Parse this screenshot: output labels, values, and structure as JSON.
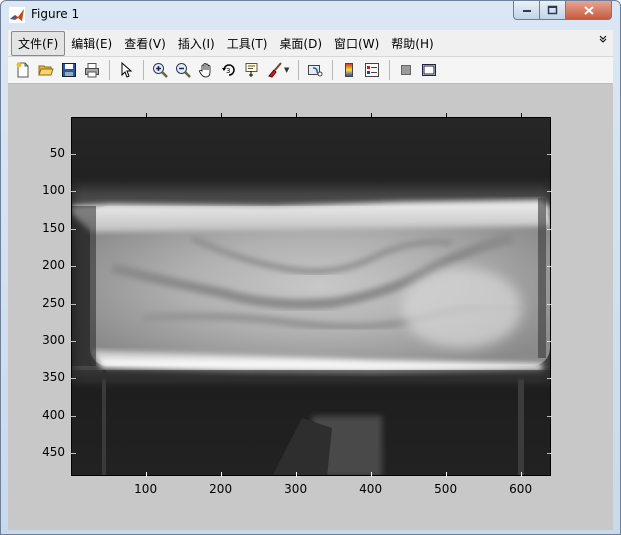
{
  "window": {
    "title": "Figure 1",
    "controls": {
      "minimize": "minimize",
      "maximize": "maximize",
      "close": "close"
    }
  },
  "menubar": {
    "items": [
      {
        "label": "文件(F)",
        "active": true
      },
      {
        "label": "编辑(E)"
      },
      {
        "label": "查看(V)"
      },
      {
        "label": "插入(I)"
      },
      {
        "label": "工具(T)"
      },
      {
        "label": "桌面(D)"
      },
      {
        "label": "窗口(W)"
      },
      {
        "label": "帮助(H)"
      }
    ]
  },
  "toolbar": {
    "icons": [
      "new-figure-icon",
      "open-file-icon",
      "save-icon",
      "print-icon",
      "edit-plot-arrow-icon",
      "zoom-in-icon",
      "zoom-out-icon",
      "pan-hand-icon",
      "rotate-3d-icon",
      "data-cursor-icon",
      "brush-icon",
      "link-plot-icon",
      "colorbar-icon",
      "legend-icon",
      "hide-plot-tools-icon",
      "show-plot-tools-icon"
    ]
  },
  "plot": {
    "type": "image",
    "y_ticks": [
      "50",
      "100",
      "150",
      "200",
      "250",
      "300",
      "350",
      "400",
      "450"
    ],
    "x_ticks": [
      "100",
      "200",
      "300",
      "400",
      "500",
      "600"
    ],
    "x_range": [
      0.5,
      640.5
    ],
    "y_range": [
      0.5,
      480.5
    ],
    "image_description_colors": {
      "background": "#1e1e1e",
      "bright": "#f2f2f2"
    }
  }
}
